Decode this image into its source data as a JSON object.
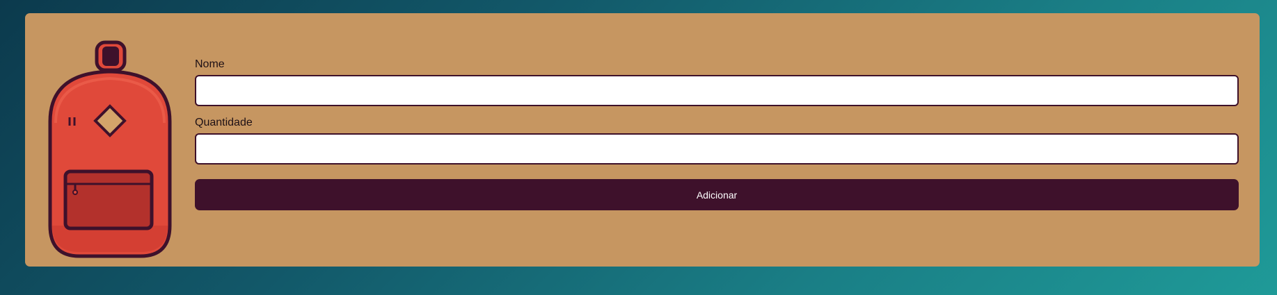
{
  "form": {
    "name_label": "Nome",
    "name_value": "",
    "quantity_label": "Quantidade",
    "quantity_value": "",
    "add_button_label": "Adicionar"
  },
  "colors": {
    "background_gradient_start": "#0c3a4d",
    "background_gradient_end": "#1f9a98",
    "card_background": "#c69661",
    "button_background": "#3e112b",
    "input_border": "#3d1029",
    "backpack_body": "#e0493a",
    "backpack_pocket": "#b3312c",
    "backpack_outline": "#3e112b"
  },
  "icons": {
    "illustration": "backpack-icon"
  }
}
